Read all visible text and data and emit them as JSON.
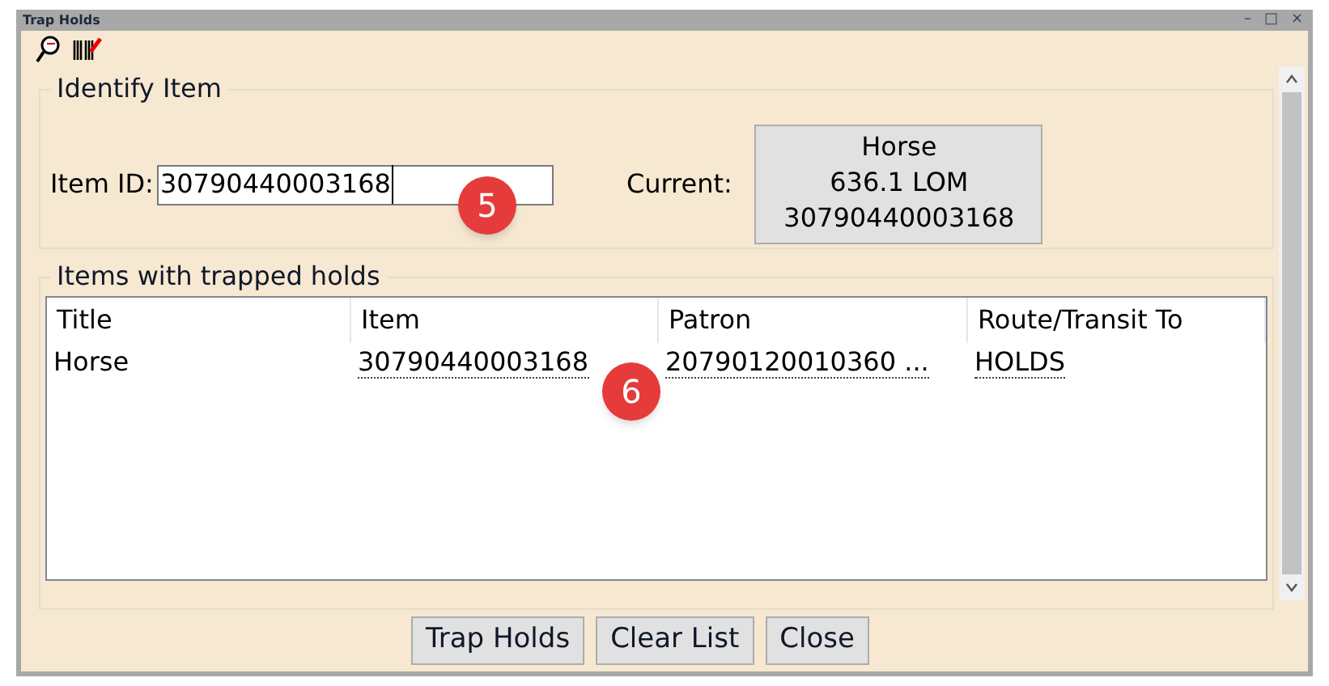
{
  "window": {
    "title": "Trap Holds",
    "controls": [
      "–",
      "□",
      "×"
    ]
  },
  "identify": {
    "legend": "Identify Item",
    "item_id_label": "Item ID:",
    "item_id_value": "30790440003168",
    "current_label": "Current:",
    "current_lines": [
      "Horse",
      "636.1 LOM",
      "30790440003168"
    ]
  },
  "holds": {
    "legend": "Items with trapped holds",
    "columns": [
      "Title",
      "Item",
      "Patron",
      "Route/Transit To"
    ],
    "rows": [
      {
        "cells": [
          "Horse",
          "30790440003168",
          "20790120010360 ...",
          "HOLDS"
        ],
        "selected": false
      }
    ]
  },
  "buttons": [
    "Trap Holds",
    "Clear List",
    "Close"
  ],
  "callouts": [
    "5",
    "6"
  ]
}
